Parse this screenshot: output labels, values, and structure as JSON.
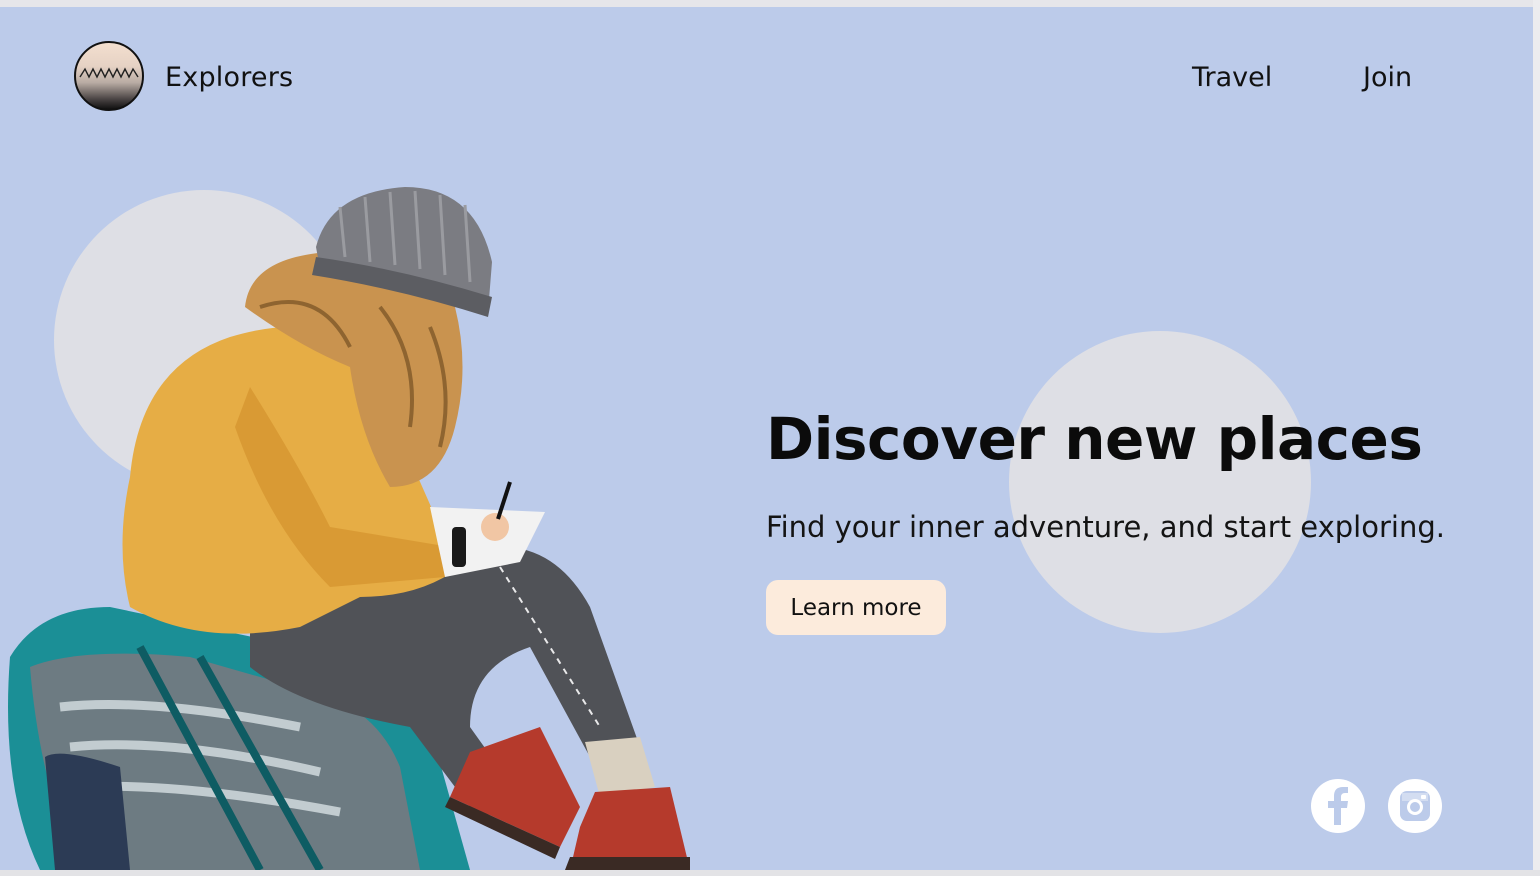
{
  "brand": {
    "name": "Explorers",
    "logo_icon": "mountain-logo-icon"
  },
  "nav": {
    "items": [
      {
        "label": "Travel"
      },
      {
        "label": "Join"
      }
    ]
  },
  "hero": {
    "title": "Discover new places",
    "subtitle": "Find your inner adventure, and start exploring.",
    "cta_label": "Learn more",
    "image_icon": "hiker-writing-photo"
  },
  "social": {
    "icons": [
      "facebook-icon",
      "instagram-icon"
    ]
  },
  "colors": {
    "background": "#bccbea",
    "circle": "#dedfe5",
    "cta_background": "#fcebdc",
    "text": "#111111"
  }
}
